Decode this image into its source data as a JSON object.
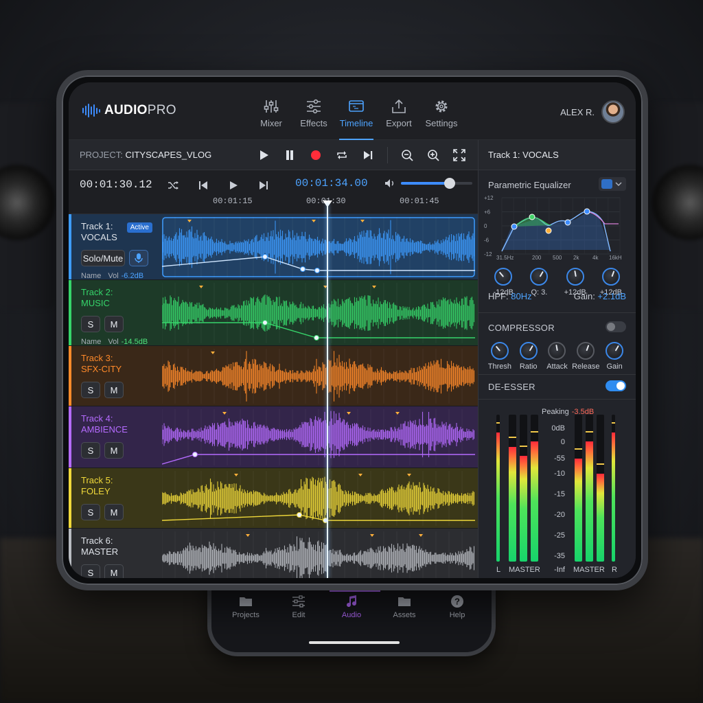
{
  "app": {
    "logo_main": "AUDIO",
    "logo_accent": "PRO"
  },
  "nav": [
    {
      "id": "mixer",
      "label": "Mixer",
      "icon": "mixer-sliders-icon"
    },
    {
      "id": "effects",
      "label": "Effects",
      "icon": "effects-sliders-icon"
    },
    {
      "id": "timeline",
      "label": "Timeline",
      "icon": "timeline-icon",
      "active": true
    },
    {
      "id": "export",
      "label": "Export",
      "icon": "export-icon"
    },
    {
      "id": "settings",
      "label": "Settings",
      "icon": "gear-icon"
    }
  ],
  "user": {
    "name": "ALEX R."
  },
  "project": {
    "prefix": "PROJECT: ",
    "name": "CITYSCAPES_VLOG"
  },
  "transport": {
    "current_time": "00:01:30.12",
    "play_time": "00:01:34.00",
    "volume_percent": 68,
    "ticks": [
      "00:01:15",
      "00:01:30",
      "00:01:45"
    ]
  },
  "tracks": [
    {
      "title": "Track 1:",
      "name": "VOCALS",
      "color": "#3d9cff",
      "bg": "#1e3550",
      "badge": "Active",
      "btns": [
        "Solo/Mute",
        "mic-icon"
      ],
      "meta_name": "Name",
      "meta_vol_label": "Vol",
      "meta_vol": "-6.2dB",
      "vol_color": "#4da3ff"
    },
    {
      "title": "Track 2:",
      "name": "MUSIC",
      "color": "#36d46a",
      "bg": "#1d3a28",
      "btns": [
        "S",
        "M"
      ],
      "meta_name": "Name",
      "meta_vol_label": "Vol",
      "meta_vol": "-14.5dB",
      "vol_color": "#4ee37a"
    },
    {
      "title": "Track 3:",
      "name": "SFX-CITY",
      "color": "#ff8a2a",
      "bg": "#3a2818",
      "btns": [
        "S",
        "M"
      ]
    },
    {
      "title": "Track 4:",
      "name": "AMBIENCE",
      "color": "#b56bff",
      "bg": "#33254a",
      "btns": [
        "S",
        "M"
      ]
    },
    {
      "title": "Track 5:",
      "name": "FOLEY",
      "color": "#f0d93a",
      "bg": "#3a3718",
      "btns": [
        "S",
        "M"
      ]
    },
    {
      "title": "Track 6:",
      "name": "MASTER",
      "color": "#b9bcc2",
      "bg": "#2c2d31",
      "btns": [
        "S",
        "M"
      ]
    }
  ],
  "panel": {
    "title": "Track 1: VOCALS",
    "eq": {
      "title": "Parametric Equalizer",
      "db_labels": [
        "+12",
        "+6",
        "0",
        "-6",
        "-12"
      ],
      "freq_labels": [
        "31.5Hz",
        "200",
        "500",
        "2k",
        "4k",
        "16kHz"
      ],
      "knobs": [
        "-12dB",
        "Q: 3.",
        "+12dB",
        "+12dB"
      ],
      "hpf_label": "HPF: ",
      "hpf_value": "80Hz",
      "gain_label": "Gain: ",
      "gain_value": "+2.1dB"
    },
    "compressor": {
      "title": "COMPRESSOR",
      "enabled": false,
      "knobs": [
        "Thresh",
        "Ratio",
        "Attack",
        "Release",
        "Gain"
      ]
    },
    "deesser": {
      "title": "DE-ESSER",
      "enabled": true
    },
    "meters": {
      "peak_label": "Peaking",
      "peak_value": "-3.5dB",
      "scale": [
        "0dB",
        "0",
        "-55",
        "-10",
        "-15",
        "-20",
        "-25",
        "-35",
        "-Inf"
      ],
      "left_label": "L",
      "right_label": "R",
      "master_label_1": "MASTER",
      "master_label_2": "MASTER",
      "levels": [
        0.88,
        0.78,
        0.72,
        0.82,
        0.7,
        0.82,
        0.6
      ]
    }
  },
  "phone_nav": [
    {
      "label": "Projects",
      "icon": "folder-icon"
    },
    {
      "label": "Edit",
      "icon": "sliders-icon"
    },
    {
      "label": "Audio",
      "icon": "music-note-icon",
      "active": true
    },
    {
      "label": "Assets",
      "icon": "folder-icon"
    },
    {
      "label": "Help",
      "icon": "help-icon"
    }
  ]
}
